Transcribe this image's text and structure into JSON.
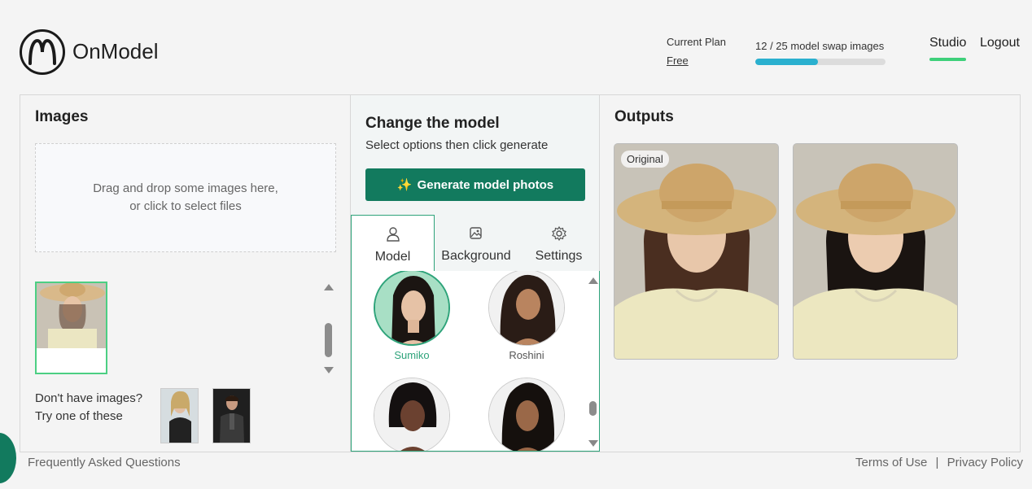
{
  "app": {
    "brand": "OnModel"
  },
  "header": {
    "plan_label": "Current Plan",
    "plan_value": "Free",
    "usage_text": "12 / 25 model swap images",
    "usage_used": 12,
    "usage_total": 25,
    "nav": {
      "studio": "Studio",
      "logout": "Logout"
    }
  },
  "images": {
    "title": "Images",
    "dropzone_line1": "Drag and drop some images here,",
    "dropzone_line2": "or click to select files",
    "samples_line1": "Don't have images?",
    "samples_line2": "Try one of these"
  },
  "model": {
    "title": "Change the model",
    "subtitle": "Select options then click generate",
    "generate_label": "Generate model photos",
    "tabs": [
      {
        "label": "Model",
        "icon": "person-icon"
      },
      {
        "label": "Background",
        "icon": "image-edit-icon"
      },
      {
        "label": "Settings",
        "icon": "gear-icon"
      }
    ],
    "models": [
      {
        "name": "Sumiko",
        "selected": true
      },
      {
        "name": "Roshini",
        "selected": false
      },
      {
        "name": "",
        "selected": false
      },
      {
        "name": "",
        "selected": false
      }
    ]
  },
  "outputs": {
    "title": "Outputs",
    "original_badge": "Original"
  },
  "footer": {
    "faq": "Frequently Asked Questions",
    "terms": "Terms of Use",
    "separator": "|",
    "privacy": "Privacy Policy"
  },
  "colors": {
    "accent_green": "#127a5e",
    "tab_border": "#2ea37a",
    "usage_fill": "#2ab0cf",
    "nav_underline": "#3ed07a"
  }
}
